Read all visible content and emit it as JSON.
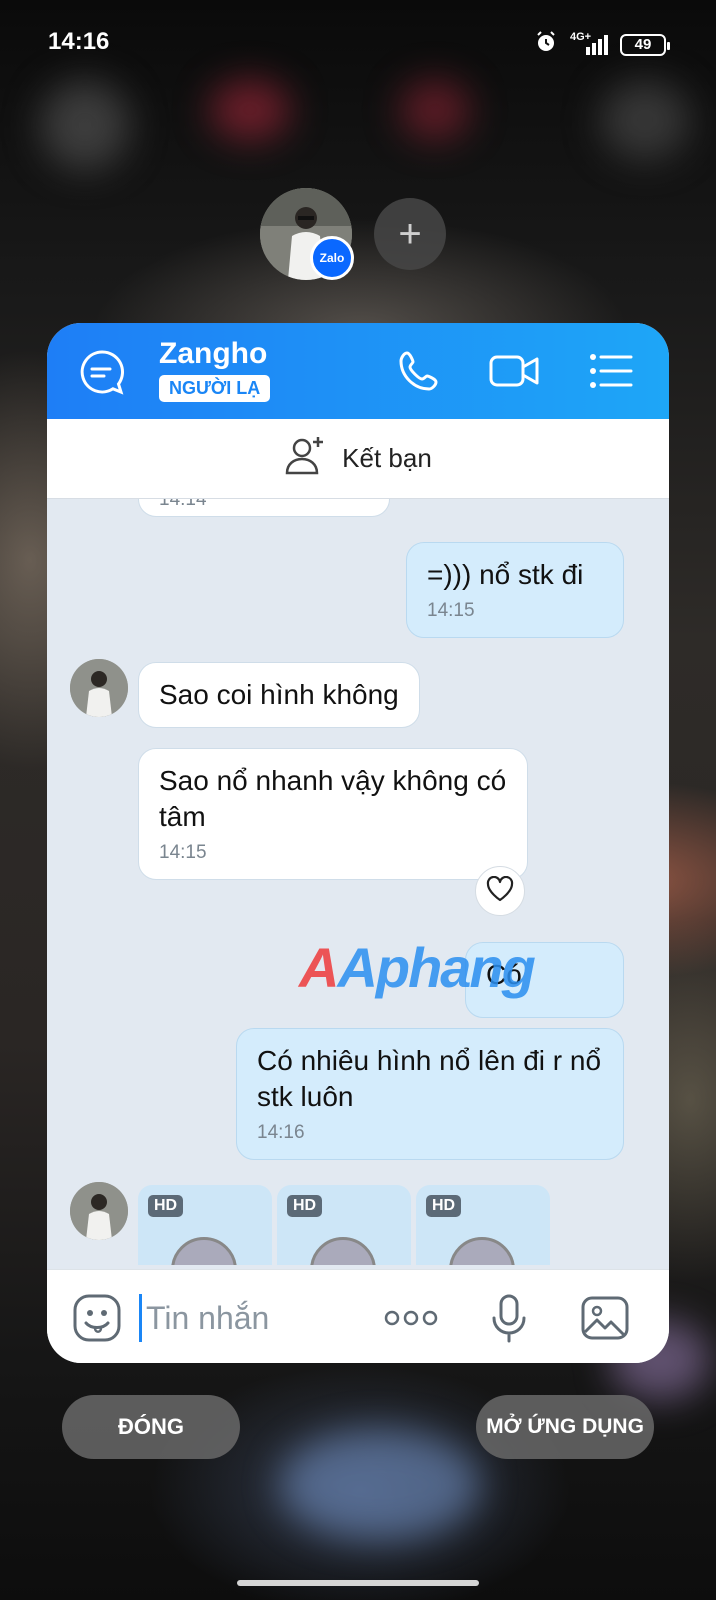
{
  "status_bar": {
    "time": "14:16",
    "network": "4G+",
    "battery": "49"
  },
  "chat_head": {
    "add_label": "+",
    "app_badge": "Zalo"
  },
  "header": {
    "contact_name": "Zangho",
    "stranger_badge": "NGƯỜI LẠ"
  },
  "friend_bar": {
    "label": "Kết bạn"
  },
  "messages": [
    {
      "dir": "in",
      "text": "",
      "time": "14:14"
    },
    {
      "dir": "out",
      "text": "=))) nổ stk đi",
      "time": "14:15"
    },
    {
      "dir": "in",
      "text": "Sao coi hình không",
      "time": ""
    },
    {
      "dir": "in",
      "text": "Sao nổ nhanh vậy không có tâm",
      "time": "14:15"
    },
    {
      "dir": "out",
      "text": "Có",
      "time": ""
    },
    {
      "dir": "out",
      "text": "Có nhiêu hình nổ lên đi r nổ stk luôn",
      "time": "14:16"
    }
  ],
  "image_messages": [
    {
      "badge": "HD"
    },
    {
      "badge": "HD"
    },
    {
      "badge": "HD"
    }
  ],
  "watermark": "Aphang",
  "composer": {
    "placeholder": "Tin nhắn",
    "more_label": "ooo"
  },
  "actions": {
    "close_label": "ĐÓNG",
    "open_label": "MỞ ỨNG DỤNG"
  },
  "colors": {
    "accent": "#1a86f6",
    "outgoing_bubble": "#d4ecfc",
    "chat_bg": "#e2e9f1"
  }
}
